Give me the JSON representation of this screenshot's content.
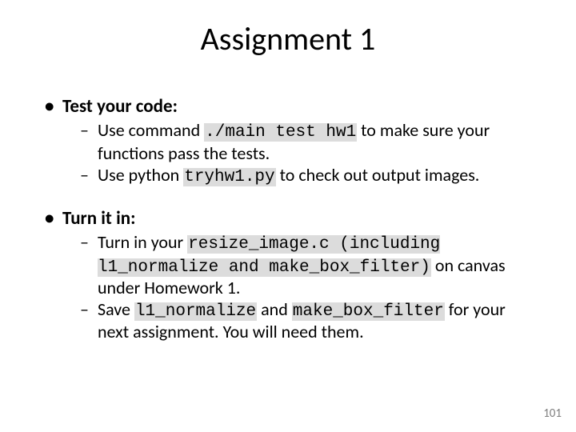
{
  "title": "Assignment 1",
  "sections": [
    {
      "header": "Test your code:",
      "items": [
        {
          "pre": "Use command ",
          "code1": "./main test hw1",
          "mid": " to make sure your functions pass the tests."
        },
        {
          "pre": "Use python ",
          "code1": "tryhw1.py",
          "mid": " to check out output images."
        }
      ]
    },
    {
      "header": "Turn it in:",
      "items": [
        {
          "pre": "Turn in your ",
          "code1": "resize_image.c (including l1_normalize and make_box_filter)",
          "mid": " on canvas under Homework 1."
        },
        {
          "pre": "Save ",
          "code1": "l1_normalize",
          "mid": " and ",
          "code2": "make_box_filter",
          "post": " for your next assignment. You will need them."
        }
      ]
    }
  ],
  "page_number": "101"
}
